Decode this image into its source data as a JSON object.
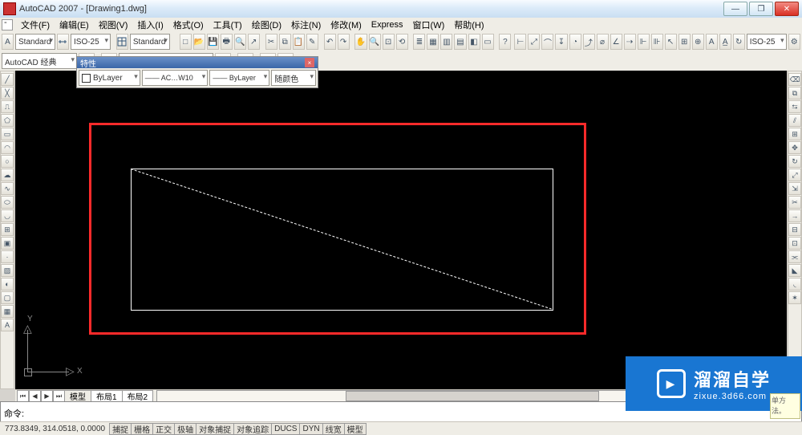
{
  "title": {
    "app": "AutoCAD 2007",
    "doc": "[Drawing1.dwg]"
  },
  "menu": {
    "file": "文件(F)",
    "edit": "编辑(E)",
    "view": "视图(V)",
    "insert": "插入(I)",
    "format": "格式(O)",
    "tools": "工具(T)",
    "draw": "绘图(D)",
    "dim": "标注(N)",
    "modify": "修改(M)",
    "express": "Express",
    "window": "窗口(W)",
    "help": "帮助(H)"
  },
  "row1": {
    "styleA": "Standard",
    "dimstyle": "ISO-25",
    "styleB": "Standard",
    "dimstyle2": "ISO-25"
  },
  "row2": {
    "workspace": "AutoCAD 经典"
  },
  "prop": {
    "title": "特性",
    "layer": "ByLayer",
    "ltype": "—— AC…W10",
    "lweight": "—— ByLayer",
    "color": "随颜色"
  },
  "tabs": {
    "model": "模型",
    "layout1": "布局1",
    "layout2": "布局2"
  },
  "cmd": {
    "prompt": "命令:"
  },
  "status": {
    "coord": "773.8349, 314.0518, 0.0000",
    "snap": "捕捉",
    "grid": "栅格",
    "ortho": "正交",
    "polar": "极轴",
    "osnap": "对象捕捉",
    "otrack": "对象追踪",
    "ducs": "DUCS",
    "dyn": "DYN",
    "lwt": "线宽",
    "model": "模型"
  },
  "ucs": {
    "x": "X",
    "y": "Y"
  },
  "watermark": {
    "brand": "溜溜自学",
    "site": "zixue.3d66.com"
  },
  "tip": {
    "text": "单方法。"
  }
}
